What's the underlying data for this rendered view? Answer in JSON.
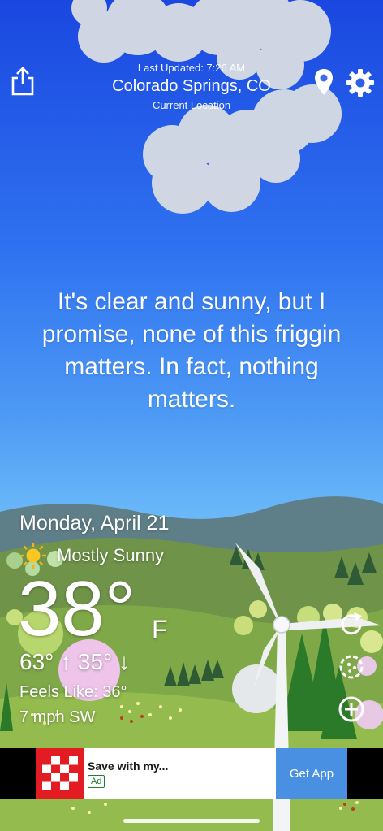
{
  "header": {
    "last_updated": "Last Updated: 7:26 AM",
    "location": "Colorado Springs, CO",
    "location_subtitle": "Current Location"
  },
  "icons": {
    "share": "share-icon",
    "location": "location-pin-icon",
    "settings": "gear-icon",
    "condition": "sun-icon",
    "refresh": "refresh-icon",
    "radar": "radar-icon",
    "add": "plus-circle-icon"
  },
  "forecast_message": "It's clear and sunny, but I promise, none of this friggin matters. In fact, nothing matters.",
  "weather": {
    "date": "Monday, April 21",
    "condition": "Mostly Sunny",
    "temperature": "38°",
    "unit": "F",
    "high_low": "63° ↑ 35° ↓",
    "feels_like": "Feels Like: 36°",
    "wind": "7 mph SW"
  },
  "ad": {
    "title": "Save with my...",
    "badge": "Ad",
    "cta": "Get App"
  },
  "colors": {
    "sky_top": "#1a47e0",
    "sky_bottom": "#7ec6f8",
    "hill_dark": "#5d8a45",
    "hill_light": "#8fba4d",
    "ad_brand": "#e31b23",
    "cta_blue": "#4a90e2"
  }
}
